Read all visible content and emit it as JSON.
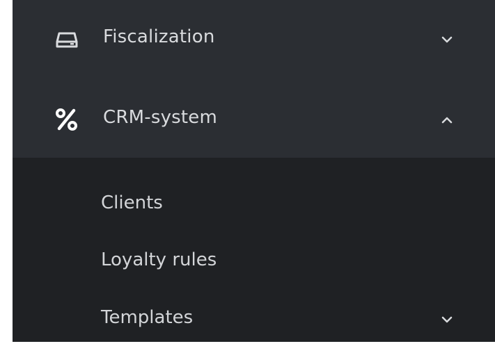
{
  "menu": {
    "fiscalization": {
      "label": "Fiscalization",
      "icon": "drive-icon",
      "expanded": false
    },
    "crm": {
      "label": "CRM-system",
      "icon": "percent-icon",
      "expanded": true,
      "submenu": [
        {
          "label": "Clients"
        },
        {
          "label": "Loyalty rules"
        },
        {
          "label": "Templates",
          "has_children": true,
          "expanded": false
        }
      ]
    }
  },
  "colors": {
    "background": "#2b2e33",
    "submenu_background": "#1f2124",
    "text": "#d9dbde"
  }
}
